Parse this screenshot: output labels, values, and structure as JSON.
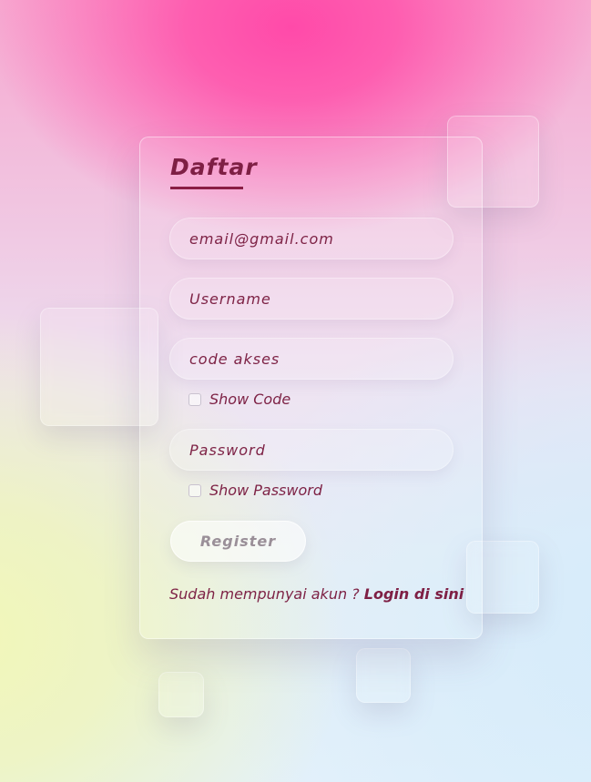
{
  "form": {
    "title": "Daftar",
    "email_placeholder": "email@gmail.com",
    "username_placeholder": "Username",
    "code_placeholder": "code akses",
    "show_code_label": "Show Code",
    "password_placeholder": "Password",
    "show_password_label": "Show Password",
    "register_label": "Register",
    "login_prompt": "Sudah mempunyai akun ? ",
    "login_link": "Login di sini"
  },
  "colors": {
    "accent": "#7e1f44",
    "text": "#7e2346",
    "button_text": "#9a8f98"
  }
}
